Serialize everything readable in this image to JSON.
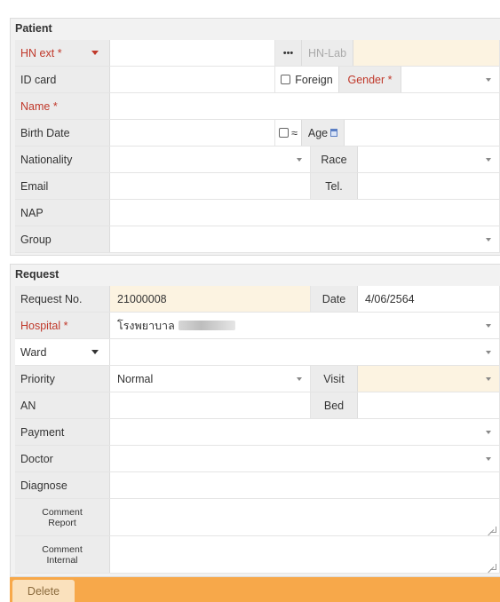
{
  "patient": {
    "title": "Patient",
    "hn_ext_label": "HN ext",
    "more_label": "•••",
    "hn_lab_label": "HN-Lab",
    "id_card_label": "ID card",
    "foreign_label": "Foreign",
    "gender_label": "Gender",
    "name_label": "Name",
    "birth_date_label": "Birth Date",
    "approx_label": "≈",
    "age_label": "Age",
    "nationality_label": "Nationality",
    "race_label": "Race",
    "email_label": "Email",
    "tel_label": "Tel.",
    "nap_label": "NAP",
    "group_label": "Group",
    "required_mark": "*"
  },
  "request": {
    "title": "Request",
    "request_no_label": "Request No.",
    "request_no_value": "21000008",
    "date_label": "Date",
    "date_value": "4/06/2564",
    "hospital_label": "Hospital",
    "hospital_value": "โรงพยาบาล",
    "ward_label": "Ward",
    "priority_label": "Priority",
    "priority_value": "Normal",
    "visit_label": "Visit",
    "an_label": "AN",
    "bed_label": "Bed",
    "payment_label": "Payment",
    "doctor_label": "Doctor",
    "diagnose_label": "Diagnose",
    "comment_report_label_1": "Comment",
    "comment_report_label_2": "Report",
    "comment_internal_label_1": "Comment",
    "comment_internal_label_2": "Internal"
  },
  "footer": {
    "delete_label": "Delete"
  },
  "colors": {
    "required": "#c0392b",
    "highlight_field": "#fcf3e1",
    "footer_bar": "#f7a84a",
    "delete_button": "#fae1bd"
  }
}
